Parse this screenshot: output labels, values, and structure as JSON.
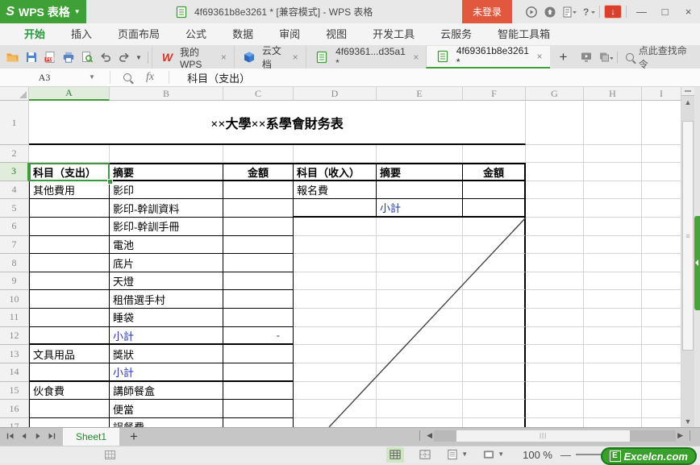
{
  "titlebar": {
    "app": "WPS 表格",
    "app_initial": "S",
    "doc_title": "4f69361b8e3261 * [兼容模式] - WPS 表格",
    "login": "未登录",
    "icons": [
      "play-circle-icon",
      "circle-arrow-icon",
      "doc-caret-icon",
      "help-caret-icon"
    ],
    "download_glyph": "↓",
    "window": [
      {
        "name": "minimize-button",
        "glyph": "—"
      },
      {
        "name": "maximize-button",
        "glyph": "□"
      },
      {
        "name": "close-button",
        "glyph": "×"
      }
    ]
  },
  "menubar": {
    "active_index": 0,
    "items": [
      "开始",
      "插入",
      "页面布局",
      "公式",
      "数据",
      "审阅",
      "视图",
      "开发工具",
      "云服务",
      "智能工具箱"
    ]
  },
  "quickbar": {
    "icons": [
      "open-folder-icon",
      "save-icon",
      "export-pdf-icon",
      "print-icon",
      "print-preview-icon",
      "undo-icon",
      "redo-icon"
    ]
  },
  "doc_tabs": {
    "tabs": [
      {
        "icon": "wps-logo-icon",
        "label": "我的WPS",
        "close": "×",
        "active": false
      },
      {
        "icon": "cloud-cube-icon",
        "label": "云文档",
        "close": "×",
        "active": false
      },
      {
        "icon": "sheet-file-icon",
        "label": "4f69361...d35a1 *",
        "close": "×",
        "active": false
      },
      {
        "icon": "sheet-file-icon",
        "label": "4f69361b8e3261 *",
        "close": "×",
        "active": true
      }
    ],
    "new_tab": "+",
    "right_icons": [
      "monitor-icon",
      "layers-caret-icon"
    ],
    "search_label": "点此查找命令"
  },
  "formula_bar": {
    "name_box": "A3",
    "fx": "fx",
    "value": "科目（支出）"
  },
  "grid": {
    "col_headers": [
      "A",
      "B",
      "C",
      "D",
      "E",
      "F",
      "G",
      "H",
      "I"
    ],
    "row_count": 17,
    "selected_cell": "A3",
    "cells": [
      {
        "ref": "A1",
        "colspan": 6,
        "text": "××大學××系學會財务表",
        "style": "title"
      },
      {
        "ref": "A3",
        "text": "科目（支出）",
        "style": "bold"
      },
      {
        "ref": "B3",
        "text": "摘要",
        "style": "bold"
      },
      {
        "ref": "C3",
        "text": "金額",
        "style": "bold center"
      },
      {
        "ref": "D3",
        "text": "科目（收入）",
        "style": "bold"
      },
      {
        "ref": "E3",
        "text": "摘要",
        "style": "bold"
      },
      {
        "ref": "F3",
        "text": "金額",
        "style": "bold center"
      },
      {
        "ref": "A4",
        "text": "其他費用"
      },
      {
        "ref": "B4",
        "text": "影印"
      },
      {
        "ref": "D4",
        "text": "報名費"
      },
      {
        "ref": "B5",
        "text": "影印-幹訓資料"
      },
      {
        "ref": "E5",
        "text": "小計",
        "style": "blue"
      },
      {
        "ref": "B6",
        "text": "影印-幹訓手冊"
      },
      {
        "ref": "B7",
        "text": "電池"
      },
      {
        "ref": "B8",
        "text": "底片"
      },
      {
        "ref": "B9",
        "text": "天燈"
      },
      {
        "ref": "B10",
        "text": "租借選手村"
      },
      {
        "ref": "B11",
        "text": "睡袋"
      },
      {
        "ref": "B12",
        "text": "小計",
        "style": "blue"
      },
      {
        "ref": "C12",
        "text": "-",
        "style": "blue right"
      },
      {
        "ref": "A13",
        "text": "文具用品"
      },
      {
        "ref": "B13",
        "text": "獎狀"
      },
      {
        "ref": "B14",
        "text": "小計",
        "style": "blue"
      },
      {
        "ref": "A15",
        "text": "伙食費"
      },
      {
        "ref": "B15",
        "text": "講師餐盒"
      },
      {
        "ref": "B16",
        "text": "便當"
      },
      {
        "ref": "B17",
        "text": "誤餐費"
      }
    ]
  },
  "sheet_tabs": {
    "nav_icons": [
      "first-sheet-icon",
      "prev-sheet-icon",
      "next-sheet-icon",
      "last-sheet-icon"
    ],
    "tabs": [
      {
        "label": "Sheet1",
        "active": true
      }
    ],
    "add_label": "+"
  },
  "status_bar": {
    "view_icons": [
      "normal-view-icon",
      "page-break-view-icon",
      "page-layout-view-icon",
      "reading-view-icon"
    ],
    "zoom_level": "100 %",
    "zoom_minus": "—",
    "brand": {
      "badge": "E",
      "name": "Excelcn.com"
    }
  },
  "colors": {
    "wps_green": "#3fa037",
    "selection_green": "#3f9640",
    "login_red": "#e2583e",
    "link_blue": "#2233aa"
  }
}
